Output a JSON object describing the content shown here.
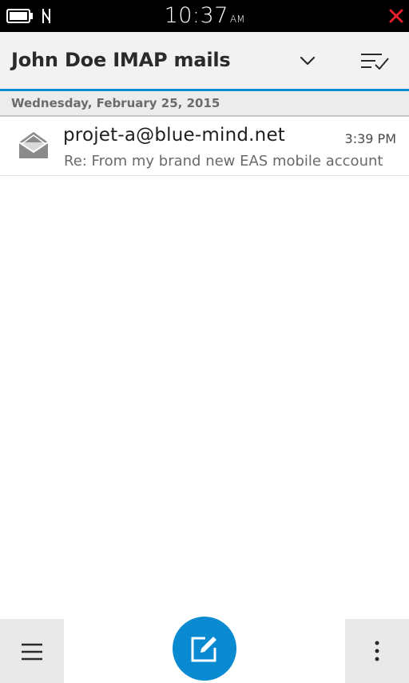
{
  "status_bar": {
    "time": "10:37",
    "ampm": "AM",
    "icons": [
      "battery-icon",
      "nfc-icon",
      "close-icon"
    ],
    "close_color": "#e3202b"
  },
  "header": {
    "title": "John Doe IMAP mails",
    "icons": [
      "chevron-down-icon",
      "multi-select-icon"
    ],
    "accent_color": "#0a8ad0"
  },
  "list": {
    "date_header": "Wednesday, February 25, 2015",
    "messages": [
      {
        "icon": "envelope-open-icon",
        "sender": "projet-a@blue-mind.net",
        "time": "3:39 PM",
        "subject": "Re: From my brand new EAS mobile account"
      }
    ]
  },
  "action_bar": {
    "icons": [
      "menu-icon",
      "compose-icon",
      "overflow-icon"
    ],
    "compose_color": "#0a8ad0"
  }
}
